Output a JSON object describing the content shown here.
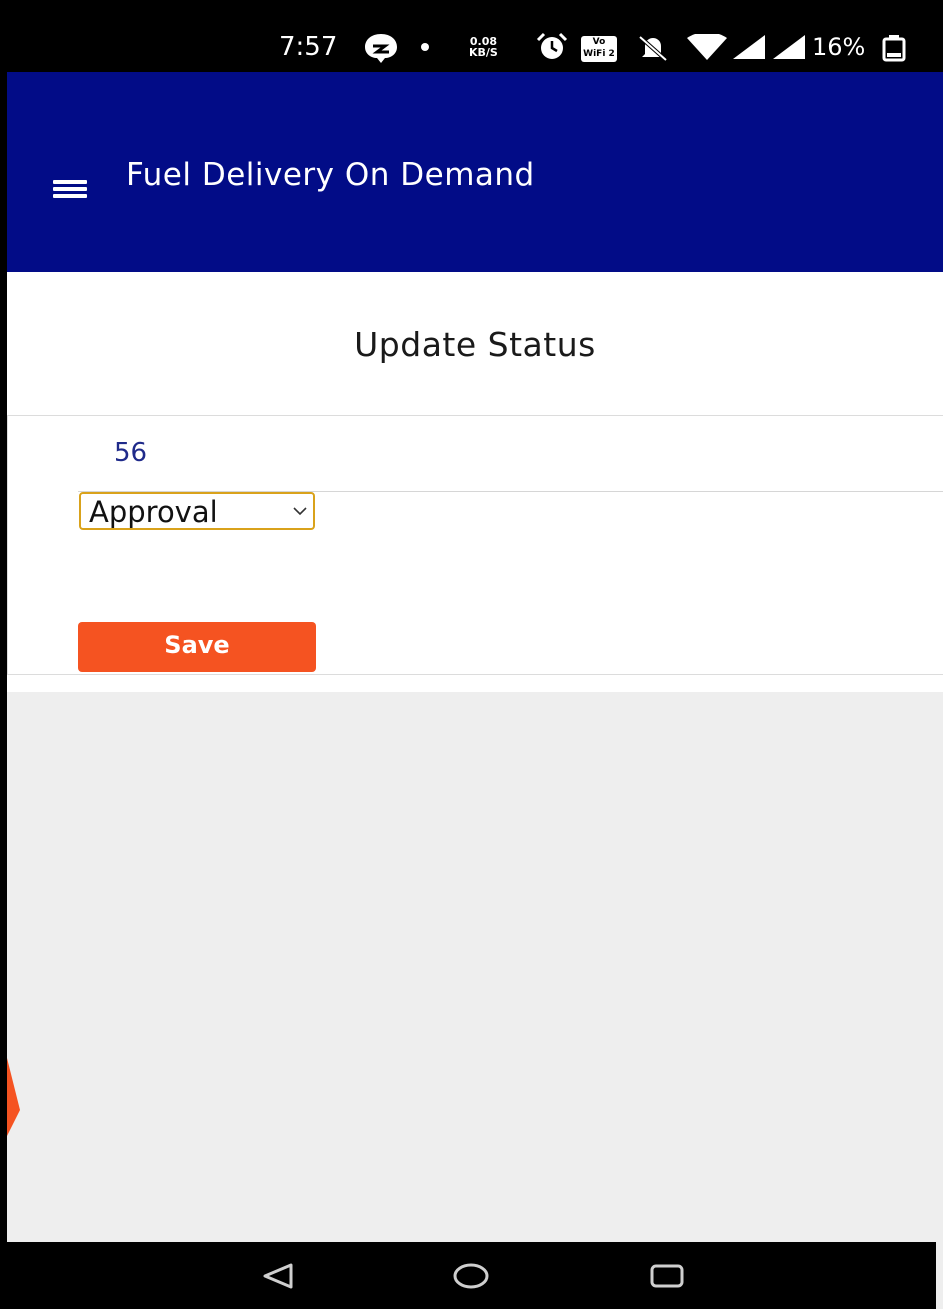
{
  "status_bar": {
    "time": "7:57",
    "network_speed": "0.08\nKB/S",
    "wifi_badge": "Vo WiFi 2",
    "battery": "16%"
  },
  "app_bar": {
    "title": "Fuel Delivery On Demand",
    "menu_icon": "hamburger-menu-icon"
  },
  "page": {
    "title": "Update Status"
  },
  "card": {
    "order_id": "56",
    "status_select": {
      "selected": "Approval"
    },
    "save_label": "Save"
  },
  "nav_bar": {
    "icons": [
      "back-icon",
      "home-icon",
      "recents-icon"
    ]
  },
  "colors": {
    "app_bar": "#020c87",
    "accent": "#f55321",
    "select_border": "#d9a21b",
    "id_text": "#1f2a8a",
    "background": "#eeeeee"
  }
}
